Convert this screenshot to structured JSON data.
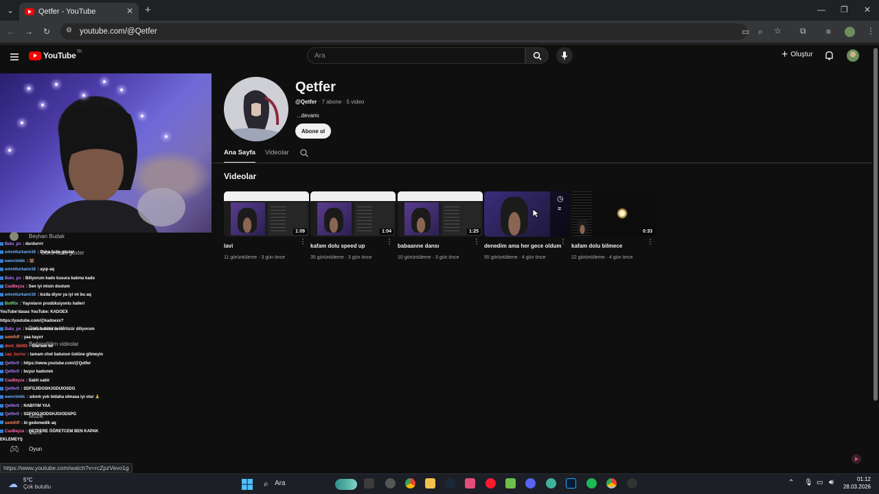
{
  "browser": {
    "tab_title": "Qetfer - YouTube",
    "url": "youtube.com/@Qetfer",
    "new_tab": "+",
    "close": "✕"
  },
  "youtube": {
    "logo_text": "YouTube",
    "region": "TR",
    "search_placeholder": "Ara",
    "create_label": "Oluştur"
  },
  "channel": {
    "name": "Qetfer",
    "handle": "@Qetfer",
    "subscribers": "7 abone",
    "videos_count": "5 video",
    "more": "...devamı",
    "subscribe": "Abone ol",
    "tabs": [
      "Ana Sayfa",
      "Videolar"
    ],
    "section_title": "Videolar"
  },
  "videos": [
    {
      "title": "lavi",
      "views": "11 görüntüleme",
      "age": "3 gün önce",
      "duration": "1:09"
    },
    {
      "title": "kafam dolu speed up",
      "views": "35 görüntüleme",
      "age": "3 gün önce",
      "duration": "1:04"
    },
    {
      "title": "babaanne dansı",
      "views": "10 görüntüleme",
      "age": "3 gün önce",
      "duration": "1:25"
    },
    {
      "title": "denedim ama her gece oldum",
      "views": "55 görüntüleme",
      "age": "4 gün önce",
      "duration": ""
    },
    {
      "title": "kafam dolu bilmece",
      "views": "22 görüntüleme",
      "age": "4 gün önce",
      "duration": "0:33"
    }
  ],
  "sidebar_ghost": {
    "beyhan": "Beyhan Budak",
    "daha_fazla": "Daha fazla göster",
    "daha_sonra": "Daha sonra izle",
    "begendiklerim": "Beğendiğim videolar",
    "muzik": "Müzik",
    "canli": "Canlı",
    "oyun": "Oyun"
  },
  "chat": [
    {
      "user": "Batu_px",
      "msg": "durdurrrr",
      "color": "#b07cff"
    },
    {
      "user": "emretturkann16",
      "msg": "Daha fazla göster",
      "color": "#6fb3ff"
    },
    {
      "user": "eeevrimkk",
      "msg": "🐻",
      "color": "#6fb3ff"
    },
    {
      "user": "emretturkann16",
      "msg": "ayıp aq",
      "color": "#6fb3ff"
    },
    {
      "user": "Batu_px",
      "msg": "Biliyorum kado kusura bakma kado",
      "color": "#b07cff"
    },
    {
      "user": "CasBeyza",
      "msg": "Sen iyi misin dostum",
      "color": "#ff6fb3"
    },
    {
      "user": "emretturkann16",
      "msg": "kızda diyor ya iyi mi bu aq",
      "color": "#6fb3ff"
    },
    {
      "user": "BotRix",
      "msg": "Yayınların prodüksiyonlu halleri",
      "color": "#7ee37e"
    },
    {
      "user": "",
      "msg": "YouTube'dasas YouTube: KADOEX",
      "color": "#ffffff"
    },
    {
      "user": "",
      "msg": "https://youtube.com/@kadoexx?",
      "color": "#ffffff"
    },
    {
      "user": "Batu_px",
      "msg": "kusura bakma senin özür diliyorum",
      "color": "#b07cff"
    },
    {
      "user": "semihff",
      "msg": "yaa hayırr",
      "color": "#ff8a5c"
    },
    {
      "user": "dont_58493",
      "msg": "izlersek mi",
      "color": "#ff5555"
    },
    {
      "user": "zap_burnu",
      "msg": "tamam chet batunun üstüne gitmeyin",
      "color": "#ff4444"
    },
    {
      "user": "Qetfer0",
      "msg": "https://www.youtube.com/@Qetfer",
      "color": "#b07cff"
    },
    {
      "user": "Qetfer0",
      "msg": "buyur kadomm",
      "color": "#b07cff"
    },
    {
      "user": "CasBeyza",
      "msg": "Sabit sabir",
      "color": "#ff6fb3"
    },
    {
      "user": "Qetfer0",
      "msg": "SDFGJIDOSHJGDUIOSDG",
      "color": "#b07cff"
    },
    {
      "user": "eeevrimkk",
      "msg": "sıkıntı yok bidaha olmasa iyi olur 🙏",
      "color": "#6fb3ff"
    },
    {
      "user": "Qetfer0",
      "msg": "NABIYIM YAA",
      "color": "#b07cff"
    },
    {
      "user": "Qetfer0",
      "msg": "SDFOIGJIODSHJGIODSPG",
      "color": "#b07cff"
    },
    {
      "user": "semihff",
      "msg": "bi gedemedik aq",
      "color": "#ff8a5c"
    },
    {
      "user": "CasBeyza",
      "msg": "QETFERE ÖĞRETCEM BEN KAPAK",
      "color": "#ff6fb3"
    },
    {
      "user": "",
      "msg": "EKLEMEYŞ",
      "color": "#ffffff"
    }
  ],
  "status_url": "https://www.youtube.com/watch?v=rcZpzVevo1g",
  "taskbar": {
    "weather_temp": "5°C",
    "weather_desc": "Çok bulutlu",
    "search_label": "Ara",
    "time": "01:12",
    "date": "28.03.2026"
  }
}
